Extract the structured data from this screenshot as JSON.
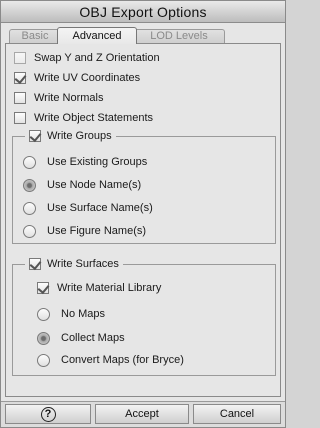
{
  "window": {
    "title": "OBJ Export Options"
  },
  "tabs": [
    {
      "label": "Basic",
      "active": false
    },
    {
      "label": "Advanced",
      "active": true
    },
    {
      "label": "LOD Levels",
      "active": false
    }
  ],
  "options": {
    "swap_yz": {
      "label": "Swap Y and Z Orientation",
      "checked": false,
      "enabled": false
    },
    "write_uv": {
      "label": "Write UV Coordinates",
      "checked": true
    },
    "write_normals": {
      "label": "Write Normals",
      "checked": false
    },
    "write_object_statements": {
      "label": "Write Object Statements",
      "checked": false
    }
  },
  "groups_section": {
    "title": "Write Groups",
    "checked": true,
    "radios": [
      {
        "label": "Use Existing Groups",
        "selected": false
      },
      {
        "label": "Use Node Name(s)",
        "selected": true
      },
      {
        "label": "Use Surface Name(s)",
        "selected": false
      },
      {
        "label": "Use Figure Name(s)",
        "selected": false
      }
    ]
  },
  "surfaces_section": {
    "title": "Write Surfaces",
    "checked": true,
    "material_library": {
      "label": "Write Material Library",
      "checked": true
    },
    "radios": [
      {
        "label": "No Maps",
        "selected": false
      },
      {
        "label": "Collect Maps",
        "selected": true
      },
      {
        "label": "Convert Maps (for Bryce)",
        "selected": false
      }
    ]
  },
  "footer": {
    "help_icon": "?",
    "accept_label": "Accept",
    "cancel_label": "Cancel"
  },
  "icons": {
    "help": "question-circle-icon"
  }
}
